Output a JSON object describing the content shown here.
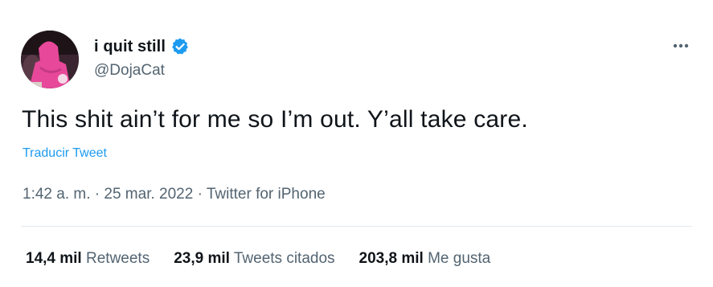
{
  "author": {
    "display_name": "i quit still",
    "handle": "@DojaCat",
    "verified": true
  },
  "tweet": {
    "text": "This shit ain’t for me so I’m out. Y’all take care.",
    "translate_label": "Traducir Tweet",
    "time": "1:42 a. m.",
    "date": "25 mar. 2022",
    "source": "Twitter for iPhone",
    "separator": "·"
  },
  "stats": [
    {
      "value": "14,4 mil",
      "label": "Retweets"
    },
    {
      "value": "23,9 mil",
      "label": "Tweets citados"
    },
    {
      "value": "203,8 mil",
      "label": "Me gusta"
    }
  ],
  "icons": {
    "verified": "verified-badge-icon",
    "more": "more-options-icon"
  },
  "colors": {
    "accent": "#1d9bf0",
    "secondary_text": "#536471",
    "primary_text": "#0f1419",
    "avatar_pink": "#e8489a"
  }
}
